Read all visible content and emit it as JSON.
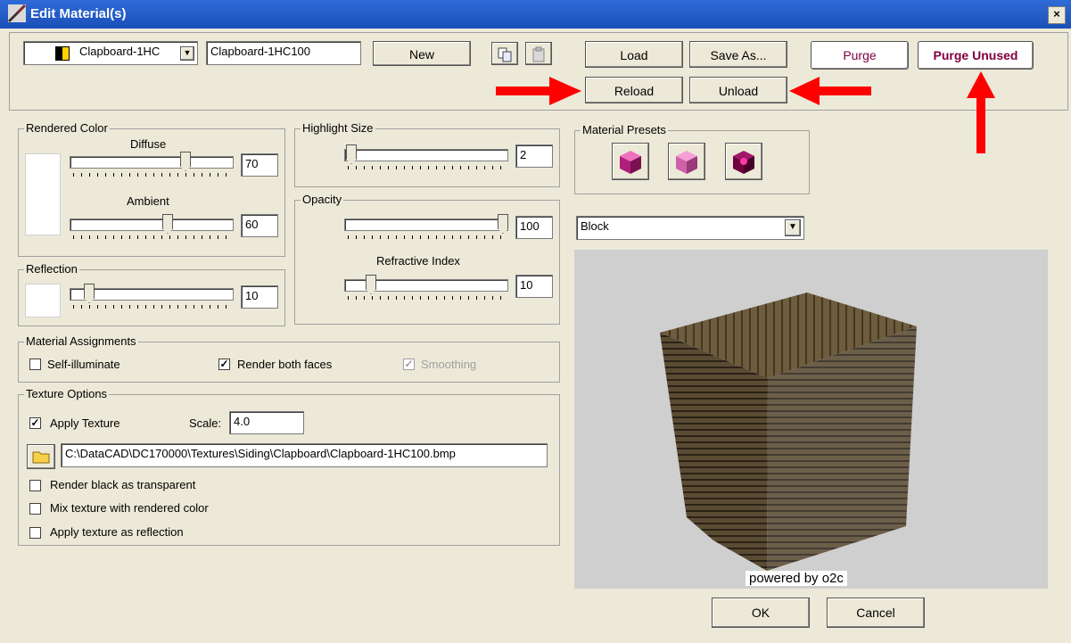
{
  "window": {
    "title": "Edit Material(s)",
    "close": "×"
  },
  "top": {
    "material_select": "Clapboard-1HC",
    "material_name": "Clapboard-1HC100",
    "new_label": "New",
    "load_label": "Load",
    "save_as_label": "Save As...",
    "reload_label": "Reload",
    "unload_label": "Unload",
    "purge_label": "Purge",
    "purge_unused_label": "Purge Unused"
  },
  "rendered_color": {
    "title": "Rendered Color",
    "diffuse_label": "Diffuse",
    "diffuse_value": "70",
    "ambient_label": "Ambient",
    "ambient_value": "60"
  },
  "reflection": {
    "title": "Reflection",
    "value": "10"
  },
  "highlight": {
    "title": "Highlight Size",
    "value": "2"
  },
  "opacity": {
    "title": "Opacity",
    "value": "100",
    "refractive_label": "Refractive Index",
    "refractive_value": "10"
  },
  "presets": {
    "title": "Material Presets"
  },
  "shape_select": "Block",
  "assignments": {
    "title": "Material Assignments",
    "self_illuminate": "Self-illuminate",
    "render_both": "Render both faces",
    "smoothing": "Smoothing"
  },
  "texture": {
    "title": "Texture Options",
    "apply_label": "Apply Texture",
    "scale_label": "Scale:",
    "scale_value": "4.0",
    "path": "C:\\DataCAD\\DC170000\\Textures\\Siding\\Clapboard\\Clapboard-1HC100.bmp",
    "black_transparent": "Render black as transparent",
    "mix_color": "Mix texture with rendered color",
    "as_reflection": "Apply texture as reflection"
  },
  "preview": {
    "caption": "powered by o2c"
  },
  "footer": {
    "ok_label": "OK",
    "cancel_label": "Cancel"
  },
  "checks": {
    "mark": "✓"
  },
  "colors": {
    "arrow": "#ff0000",
    "purge_text": "#800040",
    "titlebar": "#2458c8"
  }
}
